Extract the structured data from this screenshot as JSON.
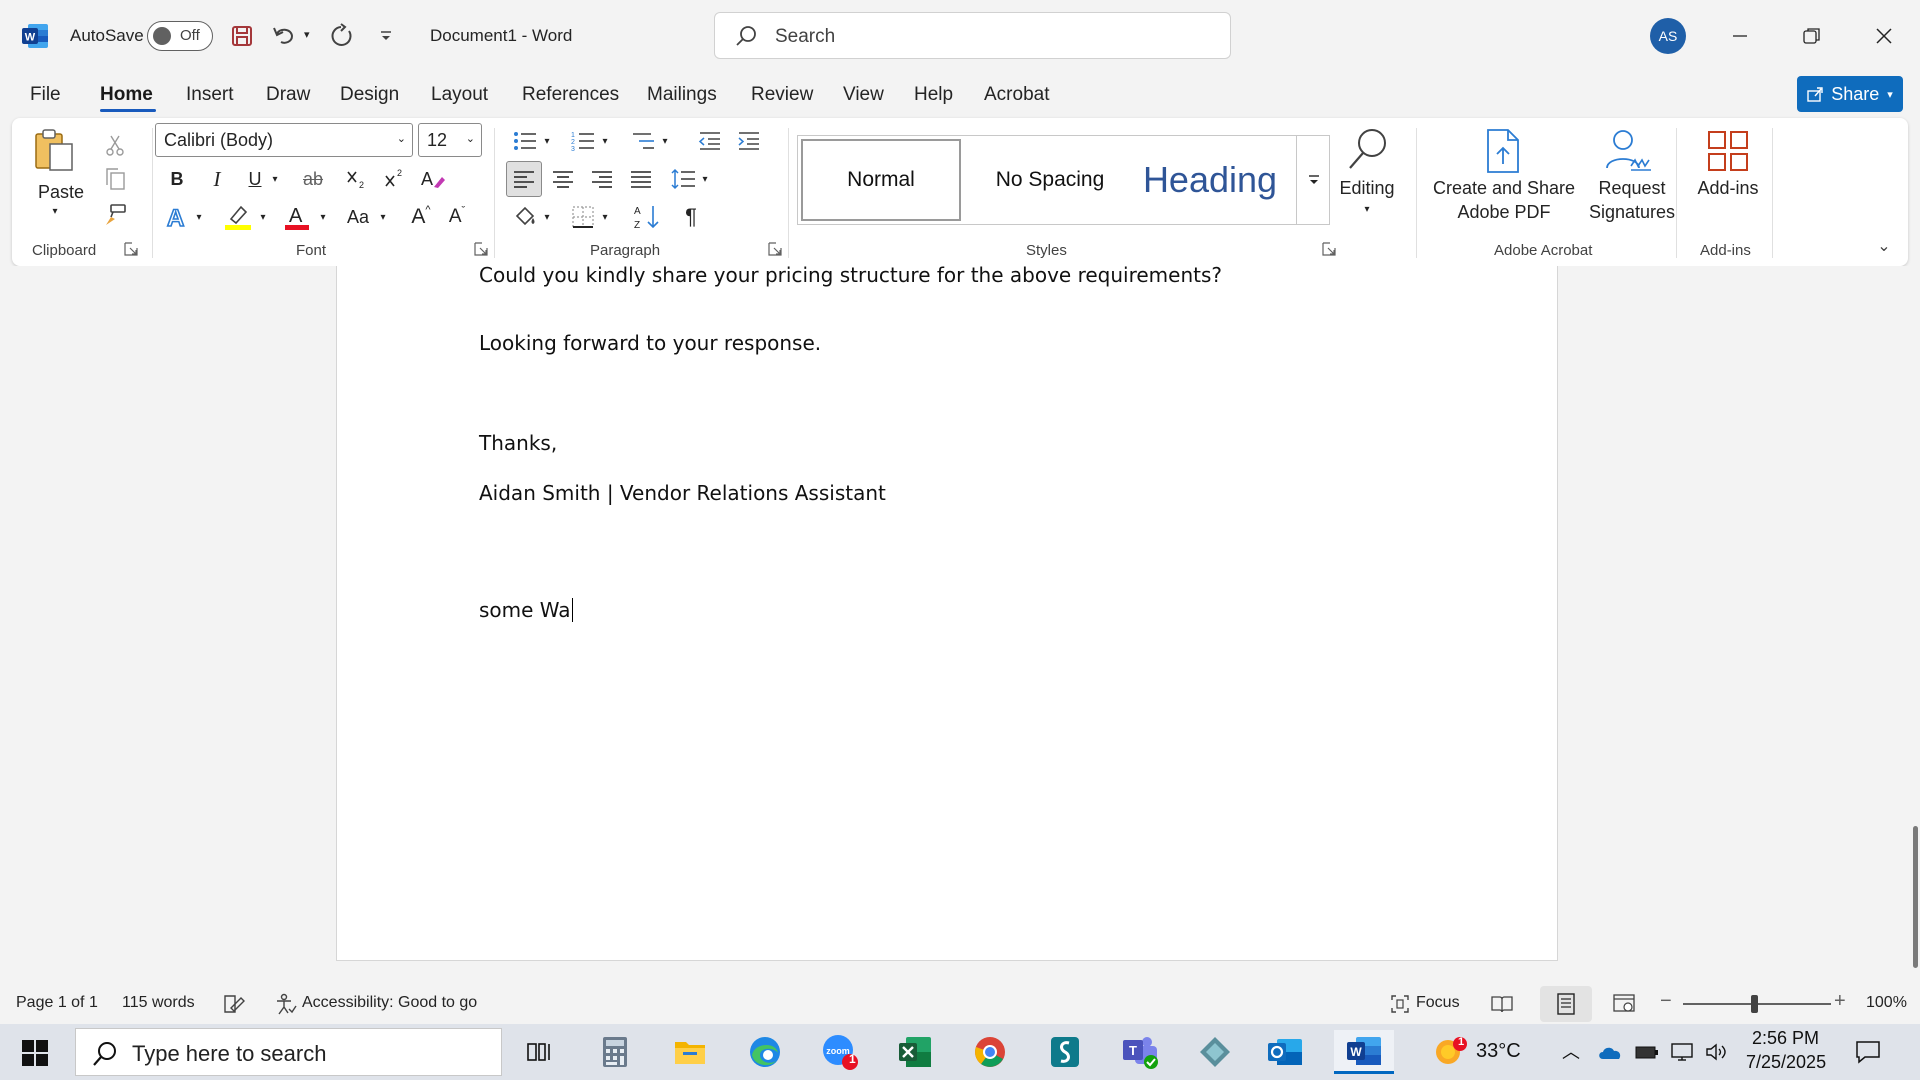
{
  "titlebar": {
    "autosave_label": "AutoSave",
    "autosave_state": "Off",
    "document_title": "Document1  -  Word",
    "search_placeholder": "Search",
    "user_initials": "AS"
  },
  "tabs": [
    "File",
    "Home",
    "Insert",
    "Draw",
    "Design",
    "Layout",
    "References",
    "Mailings",
    "Review",
    "View",
    "Help",
    "Acrobat"
  ],
  "active_tab": "Home",
  "share_label": "Share",
  "ribbon": {
    "clipboard": {
      "paste_label": "Paste",
      "group_label": "Clipboard"
    },
    "font": {
      "font_name": "Calibri (Body)",
      "font_size": "12",
      "bold": "B",
      "italic": "I",
      "underline": "U",
      "strike": "ab",
      "change_case": "Aa",
      "grow": "A",
      "shrink": "A",
      "group_label": "Font"
    },
    "paragraph": {
      "group_label": "Paragraph"
    },
    "styles": {
      "normal": "Normal",
      "no_spacing": "No Spacing",
      "heading": "Heading",
      "group_label": "Styles"
    },
    "editing": {
      "label": "Editing"
    },
    "acrobat": {
      "create_share": "Create and Share",
      "adobe_pdf": "Adobe PDF",
      "request": "Request",
      "signatures": "Signatures",
      "group_label": "Adobe Acrobat"
    },
    "addins": {
      "label": "Add-ins",
      "group_label": "Add-ins"
    }
  },
  "document": {
    "lines": [
      "Could you kindly share your pricing structure for the above requirements?",
      "Looking forward to your response.",
      "Thanks,",
      "Aidan Smith | Vendor Relations Assistant",
      "some Wa"
    ]
  },
  "statusbar": {
    "page": "Page 1 of 1",
    "words": "115 words",
    "accessibility": "Accessibility: Good to go",
    "focus": "Focus",
    "zoom": "100%",
    "zoom_level_percent": 100
  },
  "taskbar": {
    "search_placeholder": "Type here to search",
    "zoom_badge": "1",
    "weather_badge": "1",
    "temperature": "33°C",
    "time": "2:56 PM",
    "date": "7/25/2025"
  },
  "colors": {
    "accent": "#185abd",
    "share": "#0f6cbd",
    "heading_style": "#2f5597",
    "avatar": "#1f5fa8"
  }
}
